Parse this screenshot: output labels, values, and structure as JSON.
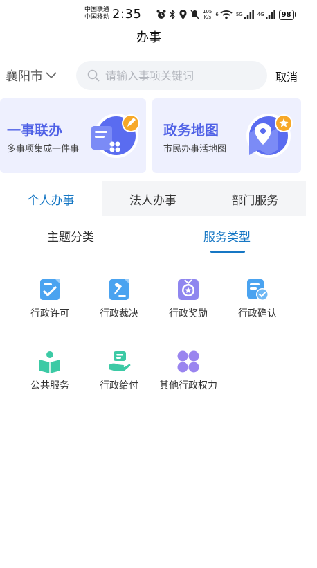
{
  "status_bar": {
    "carrier1": "中国联通",
    "carrier2": "中国移动",
    "time": "2:35",
    "net_speed_value": "105",
    "net_speed_unit": "K/s",
    "wifi_label": "6",
    "sig1_label": "5G",
    "sig2_label": "4G",
    "battery": "98"
  },
  "header": {
    "title": "办事"
  },
  "search": {
    "city": "襄阳市",
    "placeholder": "请输入事项关键词",
    "cancel": "取消"
  },
  "cards": [
    {
      "title": "一事联办",
      "subtitle": "多事项集成一件事",
      "icon": "document-pen-icon"
    },
    {
      "title": "政务地图",
      "subtitle": "市民办事活地图",
      "icon": "map-pin-icon"
    }
  ],
  "tabs": [
    {
      "label": "个人办事",
      "active": true
    },
    {
      "label": "法人办事",
      "active": false
    },
    {
      "label": "部门服务",
      "active": false
    }
  ],
  "subtabs": [
    {
      "label": "主题分类",
      "active": false
    },
    {
      "label": "服务类型",
      "active": true
    }
  ],
  "services": [
    {
      "label": "行政许可",
      "icon": "permit-check-icon"
    },
    {
      "label": "行政裁决",
      "icon": "gavel-icon"
    },
    {
      "label": "行政奖励",
      "icon": "medal-icon"
    },
    {
      "label": "行政确认",
      "icon": "confirm-doc-icon"
    },
    {
      "label": "公共服务",
      "icon": "person-book-icon"
    },
    {
      "label": "行政给付",
      "icon": "hand-payment-icon"
    },
    {
      "label": "其他行政权力",
      "icon": "clover-grid-icon"
    }
  ],
  "colors": {
    "accent": "#1677c4",
    "card_title": "#4f61e6",
    "card_bg": "#eef0fe",
    "icon_blue": "#4aa3f0",
    "icon_teal": "#3ccaa5",
    "icon_purple": "#9a85ef"
  }
}
